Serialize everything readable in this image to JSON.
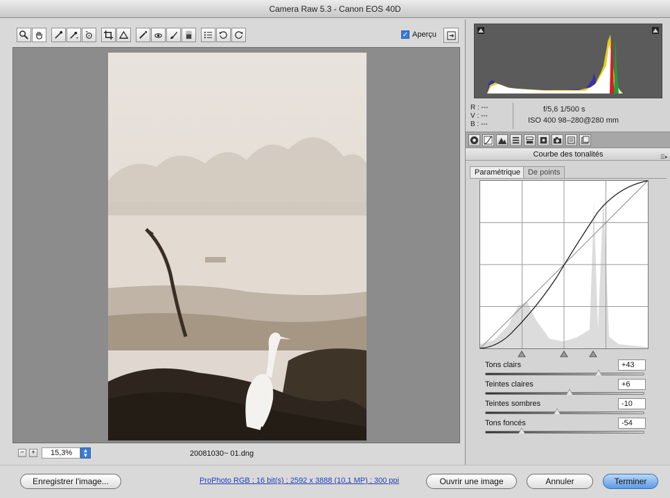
{
  "window": {
    "title": "Camera Raw 5.3  -  Canon EOS 40D"
  },
  "toolbar": {
    "tools": [
      {
        "name": "zoom-tool-icon",
        "glyph": "magnifier"
      },
      {
        "name": "hand-tool-icon",
        "glyph": "hand"
      },
      {
        "name": "white-balance-tool-icon",
        "glyph": "eyedropper"
      },
      {
        "name": "color-sampler-tool-icon",
        "glyph": "eyedropper-plus"
      },
      {
        "name": "targeted-adjustment-tool-icon",
        "glyph": "target"
      },
      {
        "name": "crop-tool-icon",
        "glyph": "crop"
      },
      {
        "name": "straighten-tool-icon",
        "glyph": "straighten"
      },
      {
        "name": "spot-removal-tool-icon",
        "glyph": "brush-spot"
      },
      {
        "name": "red-eye-tool-icon",
        "glyph": "eye"
      },
      {
        "name": "adjustment-brush-icon",
        "glyph": "brush"
      },
      {
        "name": "graduated-filter-icon",
        "glyph": "gradient"
      },
      {
        "name": "preferences-icon",
        "glyph": "list"
      },
      {
        "name": "rotate-left-icon",
        "glyph": "rotate-ccw"
      },
      {
        "name": "rotate-right-icon",
        "glyph": "rotate-cw"
      }
    ],
    "preview_label": "Aperçu",
    "preview_checked": true
  },
  "status": {
    "zoom_value": "15,3%",
    "filename": "20081030~ 01.dng"
  },
  "buttons": {
    "save": "Enregistrer l'image...",
    "open": "Ouvrir une image",
    "cancel": "Annuler",
    "done": "Terminer"
  },
  "workflow_link": "ProPhoto RGB ; 16 bit(s) ; 2592 x 3888 (10,1 MP) ; 300 ppi",
  "readout": {
    "r": "R :  ---",
    "v": "V :  ---",
    "b": "B :  ---",
    "aperture_shutter": "f/5,6   1/500 s",
    "iso_lens": "ISO 400   98–280@280 mm"
  },
  "panel": {
    "tabs": [
      "basic-tab",
      "tone-curve-tab",
      "detail-tab",
      "hsl-tab",
      "split-toning-tab",
      "lens-corrections-tab",
      "camera-calibration-tab",
      "presets-tab",
      "snapshots-tab"
    ],
    "active_tab": 1,
    "section_title": "Courbe des tonalités",
    "subtabs": [
      "Paramétrique",
      "De points"
    ],
    "active_subtab": 0
  },
  "sliders": [
    {
      "label": "Tons clairs",
      "value": "+43",
      "level": 0.715
    },
    {
      "label": "Teintes claires",
      "value": "+6",
      "level": 0.53
    },
    {
      "label": "Teintes sombres",
      "value": "-10",
      "level": 0.45
    },
    {
      "label": "Tons foncés",
      "value": "-54",
      "level": 0.23
    }
  ],
  "colors": {
    "accent_blue": "#3b7bd6",
    "link_blue": "#1f3fb7"
  }
}
